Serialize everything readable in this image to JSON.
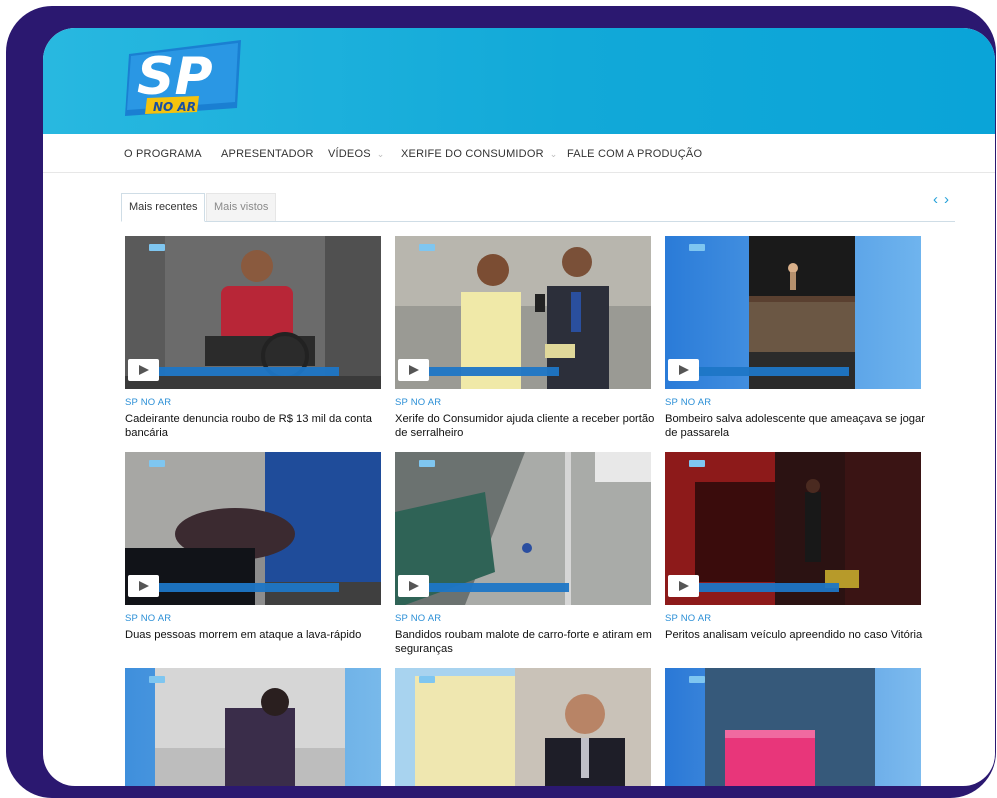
{
  "brand": {
    "logo_main": "SP",
    "logo_sub": "NO AR",
    "colors": {
      "frame": "#2b1870",
      "header": "#12a9d8",
      "accent": "#2b8fd6"
    }
  },
  "nav": {
    "items": [
      {
        "label": "O PROGRAMA",
        "has_dropdown": false
      },
      {
        "label": "APRESENTADOR",
        "has_dropdown": false
      },
      {
        "label": "VÍDEOS",
        "has_dropdown": true
      },
      {
        "label": "XERIFE DO CONSUMIDOR",
        "has_dropdown": true
      },
      {
        "label": "FALE COM A PRODUÇÃO",
        "has_dropdown": false
      }
    ]
  },
  "tabs": {
    "active": "Mais recentes",
    "inactive": "Mais vistos",
    "prev_icon": "‹",
    "next_icon": "›"
  },
  "videos": [
    {
      "category": "SP NO AR",
      "title": "Cadeirante denuncia roubo de R$ 13 mil da conta bancária",
      "icon": "play-icon"
    },
    {
      "category": "SP NO AR",
      "title": "Xerife do Consumidor ajuda cliente a receber portão de serralheiro",
      "icon": "play-icon"
    },
    {
      "category": "SP NO AR",
      "title": "Bombeiro salva adolescente que ameaçava se jogar de passarela",
      "icon": "play-icon"
    },
    {
      "category": "SP NO AR",
      "title": "Duas pessoas morrem em ataque a lava-rápido",
      "icon": "play-icon"
    },
    {
      "category": "SP NO AR",
      "title": "Bandidos roubam malote de carro-forte e atiram em seguranças",
      "icon": "play-icon"
    },
    {
      "category": "SP NO AR",
      "title": "Peritos analisam veículo apreendido no caso Vitória",
      "icon": "play-icon"
    },
    {
      "category": "",
      "title": "",
      "icon": "play-icon"
    },
    {
      "category": "",
      "title": "",
      "icon": "play-icon"
    },
    {
      "category": "",
      "title": "",
      "icon": "play-icon"
    }
  ]
}
